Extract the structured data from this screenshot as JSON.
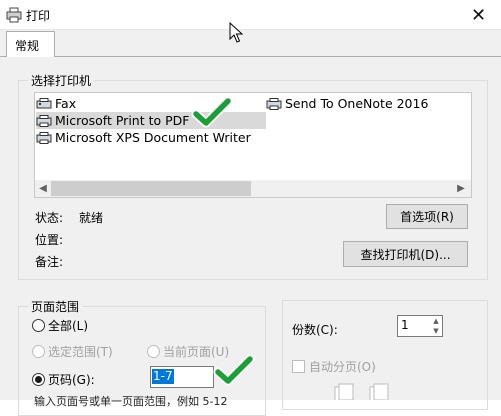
{
  "window": {
    "title": "打印",
    "close_glyph": "✕"
  },
  "tabs": [
    {
      "label": "常规"
    }
  ],
  "printer_group": {
    "label": "选择打印机",
    "printers": [
      {
        "name": "Fax",
        "icon": "fax-icon"
      },
      {
        "name": "Send To OneNote 2016",
        "icon": "printer-icon"
      },
      {
        "name": "Microsoft Print to PDF",
        "icon": "printer-icon",
        "selected": true
      },
      {
        "name": "Microsoft XPS Document Writer",
        "icon": "printer-icon"
      }
    ],
    "status_label": "状态:",
    "status_value": "就绪",
    "location_label": "位置:",
    "comment_label": "备注:",
    "preferences_button": "首选项(R)",
    "find_printer_button": "查找打印机(D)..."
  },
  "page_range": {
    "label": "页面范围",
    "options": {
      "all": "全部(L)",
      "selection": "选定范围(T)",
      "current_page": "当前页面(U)",
      "pages": "页码(G):"
    },
    "selected": "pages",
    "pages_value": "1-7",
    "hint": "输入页面号或单一页面范围，例如 5-12"
  },
  "copies": {
    "label": "份数(C):",
    "value": "1",
    "collate_label": "自动分页(O)",
    "collate_checked": false
  },
  "colors": {
    "accent": "#0078d7",
    "check_green": "#1e9e3a"
  }
}
